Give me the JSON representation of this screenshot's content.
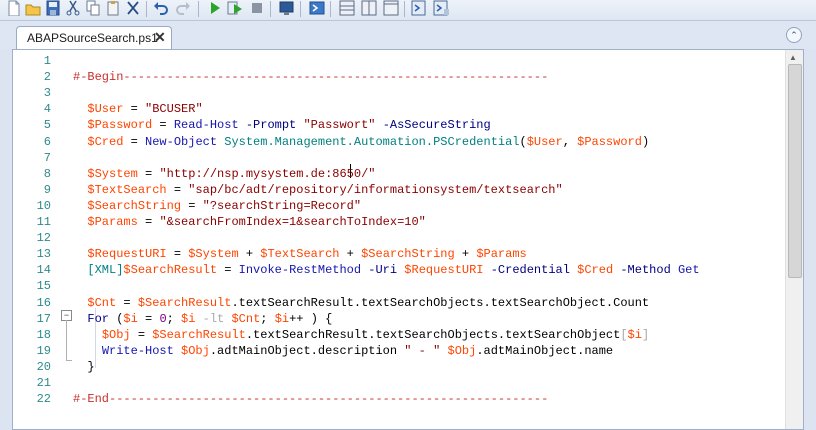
{
  "window": {
    "tab_title": "ABAPSourceSearch.ps1",
    "tab_close": "✕",
    "collapse_glyph": "⌃"
  },
  "toolbar": {
    "buttons": [
      "new-file",
      "open-file",
      "save",
      "cut",
      "copy",
      "paste",
      "clear",
      "undo",
      "redo",
      "run",
      "run-selection",
      "stop",
      "new-remote-tab",
      "start-powershell",
      "show-script-pane-top",
      "show-script-pane-right",
      "show-script-pane-max",
      "show-command-window",
      "show-command-addon"
    ]
  },
  "editor": {
    "line_numbers": [
      "1",
      "2",
      "3",
      "4",
      "5",
      "6",
      "7",
      "8",
      "9",
      "10",
      "11",
      "12",
      "13",
      "14",
      "15",
      "16",
      "17",
      "18",
      "19",
      "20",
      "21",
      "22"
    ],
    "fold_marker": "−",
    "lines": [
      [],
      [
        {
          "t": "#-Begin-----------------------------------------------------------",
          "c": "comment"
        }
      ],
      [],
      [
        {
          "t": "  ",
          "c": "plain"
        },
        {
          "t": "$User",
          "c": "var"
        },
        {
          "t": " = ",
          "c": "plain"
        },
        {
          "t": "\"BCUSER\"",
          "c": "str"
        }
      ],
      [
        {
          "t": "  ",
          "c": "plain"
        },
        {
          "t": "$Password",
          "c": "var"
        },
        {
          "t": " = ",
          "c": "plain"
        },
        {
          "t": "Read-Host",
          "c": "cmd"
        },
        {
          "t": " ",
          "c": "plain"
        },
        {
          "t": "-Prompt",
          "c": "param"
        },
        {
          "t": " ",
          "c": "plain"
        },
        {
          "t": "\"Passwort\"",
          "c": "str"
        },
        {
          "t": " ",
          "c": "plain"
        },
        {
          "t": "-AsSecureString",
          "c": "param"
        }
      ],
      [
        {
          "t": "  ",
          "c": "plain"
        },
        {
          "t": "$Cred",
          "c": "var"
        },
        {
          "t": " = ",
          "c": "plain"
        },
        {
          "t": "New-Object",
          "c": "cmd"
        },
        {
          "t": " ",
          "c": "plain"
        },
        {
          "t": "System.Management.Automation.PSCredential",
          "c": "type"
        },
        {
          "t": "(",
          "c": "plain"
        },
        {
          "t": "$User",
          "c": "var"
        },
        {
          "t": ", ",
          "c": "plain"
        },
        {
          "t": "$Password",
          "c": "var"
        },
        {
          "t": ")",
          "c": "plain"
        }
      ],
      [],
      [
        {
          "t": "  ",
          "c": "plain"
        },
        {
          "t": "$System",
          "c": "var"
        },
        {
          "t": " = ",
          "c": "plain"
        },
        {
          "t": "\"http://nsp.mysystem.de:8650/\"",
          "c": "str"
        }
      ],
      [
        {
          "t": "  ",
          "c": "plain"
        },
        {
          "t": "$TextSearch",
          "c": "var"
        },
        {
          "t": " = ",
          "c": "plain"
        },
        {
          "t": "\"sap/bc/adt/repository/informationsystem/textsearch\"",
          "c": "str"
        }
      ],
      [
        {
          "t": "  ",
          "c": "plain"
        },
        {
          "t": "$SearchString",
          "c": "var"
        },
        {
          "t": " = ",
          "c": "plain"
        },
        {
          "t": "\"?searchString=Record\"",
          "c": "str"
        }
      ],
      [
        {
          "t": "  ",
          "c": "plain"
        },
        {
          "t": "$Params",
          "c": "var"
        },
        {
          "t": " = ",
          "c": "plain"
        },
        {
          "t": "\"&searchFromIndex=1&searchToIndex=10\"",
          "c": "str"
        }
      ],
      [],
      [
        {
          "t": "  ",
          "c": "plain"
        },
        {
          "t": "$RequestURI",
          "c": "var"
        },
        {
          "t": " = ",
          "c": "plain"
        },
        {
          "t": "$System",
          "c": "var"
        },
        {
          "t": " + ",
          "c": "plain"
        },
        {
          "t": "$TextSearch",
          "c": "var"
        },
        {
          "t": " + ",
          "c": "plain"
        },
        {
          "t": "$SearchString",
          "c": "var"
        },
        {
          "t": " + ",
          "c": "plain"
        },
        {
          "t": "$Params",
          "c": "var"
        }
      ],
      [
        {
          "t": "  ",
          "c": "plain"
        },
        {
          "t": "[XML]",
          "c": "type"
        },
        {
          "t": "$SearchResult",
          "c": "var"
        },
        {
          "t": " = ",
          "c": "plain"
        },
        {
          "t": "Invoke-RestMethod",
          "c": "cmd"
        },
        {
          "t": " ",
          "c": "plain"
        },
        {
          "t": "-Uri",
          "c": "param"
        },
        {
          "t": " ",
          "c": "plain"
        },
        {
          "t": "$RequestURI",
          "c": "var"
        },
        {
          "t": " ",
          "c": "plain"
        },
        {
          "t": "-Credential",
          "c": "param"
        },
        {
          "t": " ",
          "c": "plain"
        },
        {
          "t": "$Cred",
          "c": "var"
        },
        {
          "t": " ",
          "c": "plain"
        },
        {
          "t": "-Method",
          "c": "param"
        },
        {
          "t": " ",
          "c": "plain"
        },
        {
          "t": "Get",
          "c": "cmd"
        }
      ],
      [],
      [
        {
          "t": "  ",
          "c": "plain"
        },
        {
          "t": "$Cnt",
          "c": "var"
        },
        {
          "t": " = ",
          "c": "plain"
        },
        {
          "t": "$SearchResult",
          "c": "var"
        },
        {
          "t": ".textSearchResult.textSearchObjects.textSearchObject.Count",
          "c": "plain"
        }
      ],
      [
        {
          "t": "  ",
          "c": "plain"
        },
        {
          "t": "For",
          "c": "kw"
        },
        {
          "t": " (",
          "c": "plain"
        },
        {
          "t": "$i",
          "c": "var"
        },
        {
          "t": " = ",
          "c": "plain"
        },
        {
          "t": "0",
          "c": "num"
        },
        {
          "t": "; ",
          "c": "plain"
        },
        {
          "t": "$i",
          "c": "var"
        },
        {
          "t": " ",
          "c": "plain"
        },
        {
          "t": "-lt",
          "c": "op"
        },
        {
          "t": " ",
          "c": "plain"
        },
        {
          "t": "$Cnt",
          "c": "var"
        },
        {
          "t": "; ",
          "c": "plain"
        },
        {
          "t": "$i",
          "c": "var"
        },
        {
          "t": "++ ) {",
          "c": "plain"
        }
      ],
      [
        {
          "t": "    ",
          "c": "plain"
        },
        {
          "t": "$Obj",
          "c": "var"
        },
        {
          "t": " = ",
          "c": "plain"
        },
        {
          "t": "$SearchResult",
          "c": "var"
        },
        {
          "t": ".textSearchResult.textSearchObjects.textSearchObject",
          "c": "plain"
        },
        {
          "t": "[",
          "c": "op"
        },
        {
          "t": "$i",
          "c": "var"
        },
        {
          "t": "]",
          "c": "op"
        }
      ],
      [
        {
          "t": "    ",
          "c": "plain"
        },
        {
          "t": "Write-Host",
          "c": "cmd"
        },
        {
          "t": " ",
          "c": "plain"
        },
        {
          "t": "$Obj",
          "c": "var"
        },
        {
          "t": ".adtMainObject.description ",
          "c": "plain"
        },
        {
          "t": "\" - \"",
          "c": "str"
        },
        {
          "t": " ",
          "c": "plain"
        },
        {
          "t": "$Obj",
          "c": "var"
        },
        {
          "t": ".adtMainObject.name",
          "c": "plain"
        }
      ],
      [
        {
          "t": "  }",
          "c": "plain"
        }
      ],
      [],
      [
        {
          "t": "#-End-------------------------------------------------------------",
          "c": "comment"
        }
      ]
    ]
  }
}
